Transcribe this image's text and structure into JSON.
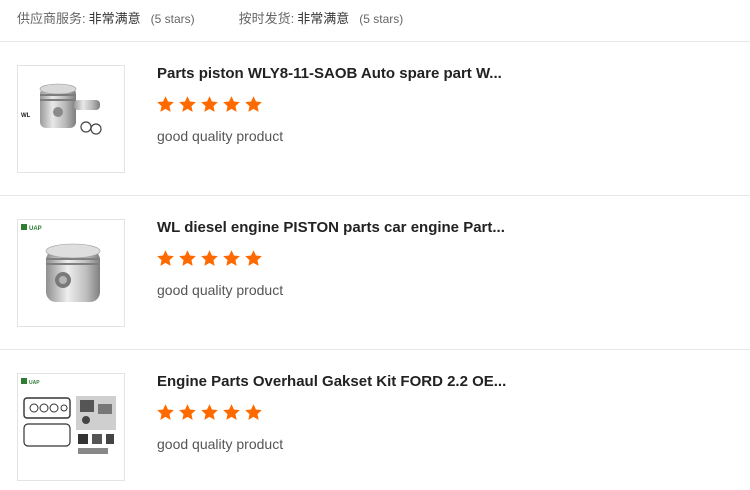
{
  "summary": {
    "supplier_service_label": "供应商服务:",
    "supplier_service_value": "非常满意",
    "supplier_service_stars": "(5 stars)",
    "ontime_delivery_label": "按时发货:",
    "ontime_delivery_value": "非常满意",
    "ontime_delivery_stars": "(5 stars)"
  },
  "colors": {
    "star": "#ff6a00",
    "divider": "#e6e6e6"
  },
  "reviews": [
    {
      "title": "Parts piston WLY8-11-SAOB Auto spare part W...",
      "rating": 5,
      "comment": "good quality product",
      "thumb_label": "WL"
    },
    {
      "title": "WL diesel engine PISTON parts car engine Part...",
      "rating": 5,
      "comment": "good quality product",
      "thumb_label": "UAP"
    },
    {
      "title": "Engine Parts Overhaul Gakset Kit FORD 2.2 OE...",
      "rating": 5,
      "comment": "good quality product",
      "thumb_label": "UAP"
    }
  ]
}
